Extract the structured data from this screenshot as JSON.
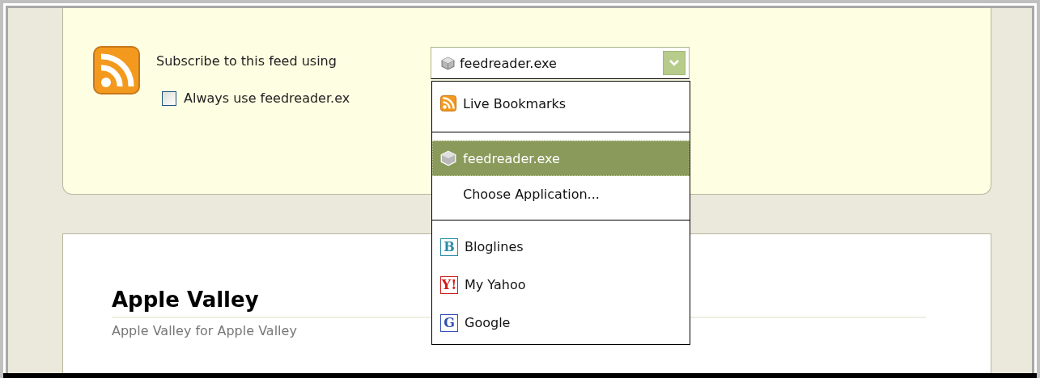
{
  "feed_subscription": {
    "prompt": "Subscribe to this feed using",
    "reader_select": {
      "value": "feedreader.exe",
      "expanded": true
    },
    "always_use": {
      "label": "Always use feedreader.ex",
      "checked": false
    },
    "menu": {
      "groups": [
        [
          {
            "kind": "rss",
            "label": "Live Bookmarks",
            "selected": false
          }
        ],
        [
          {
            "kind": "app",
            "label": "feedreader.exe",
            "selected": true
          },
          {
            "kind": "plain",
            "label": "Choose Application...",
            "selected": false
          }
        ],
        [
          {
            "kind": "logo",
            "logo": "B",
            "color": "#2a8ca8",
            "label": "Bloglines",
            "selected": false
          },
          {
            "kind": "logo",
            "logo": "Y!",
            "color": "#d01818",
            "label": "My Yahoo",
            "selected": false
          },
          {
            "kind": "logo",
            "logo": "G",
            "color": "#3050b0",
            "label": "Google",
            "selected": false
          }
        ]
      ]
    }
  },
  "feed": {
    "title": "Apple Valley",
    "subtitle": "Apple Valley for Apple Valley"
  }
}
